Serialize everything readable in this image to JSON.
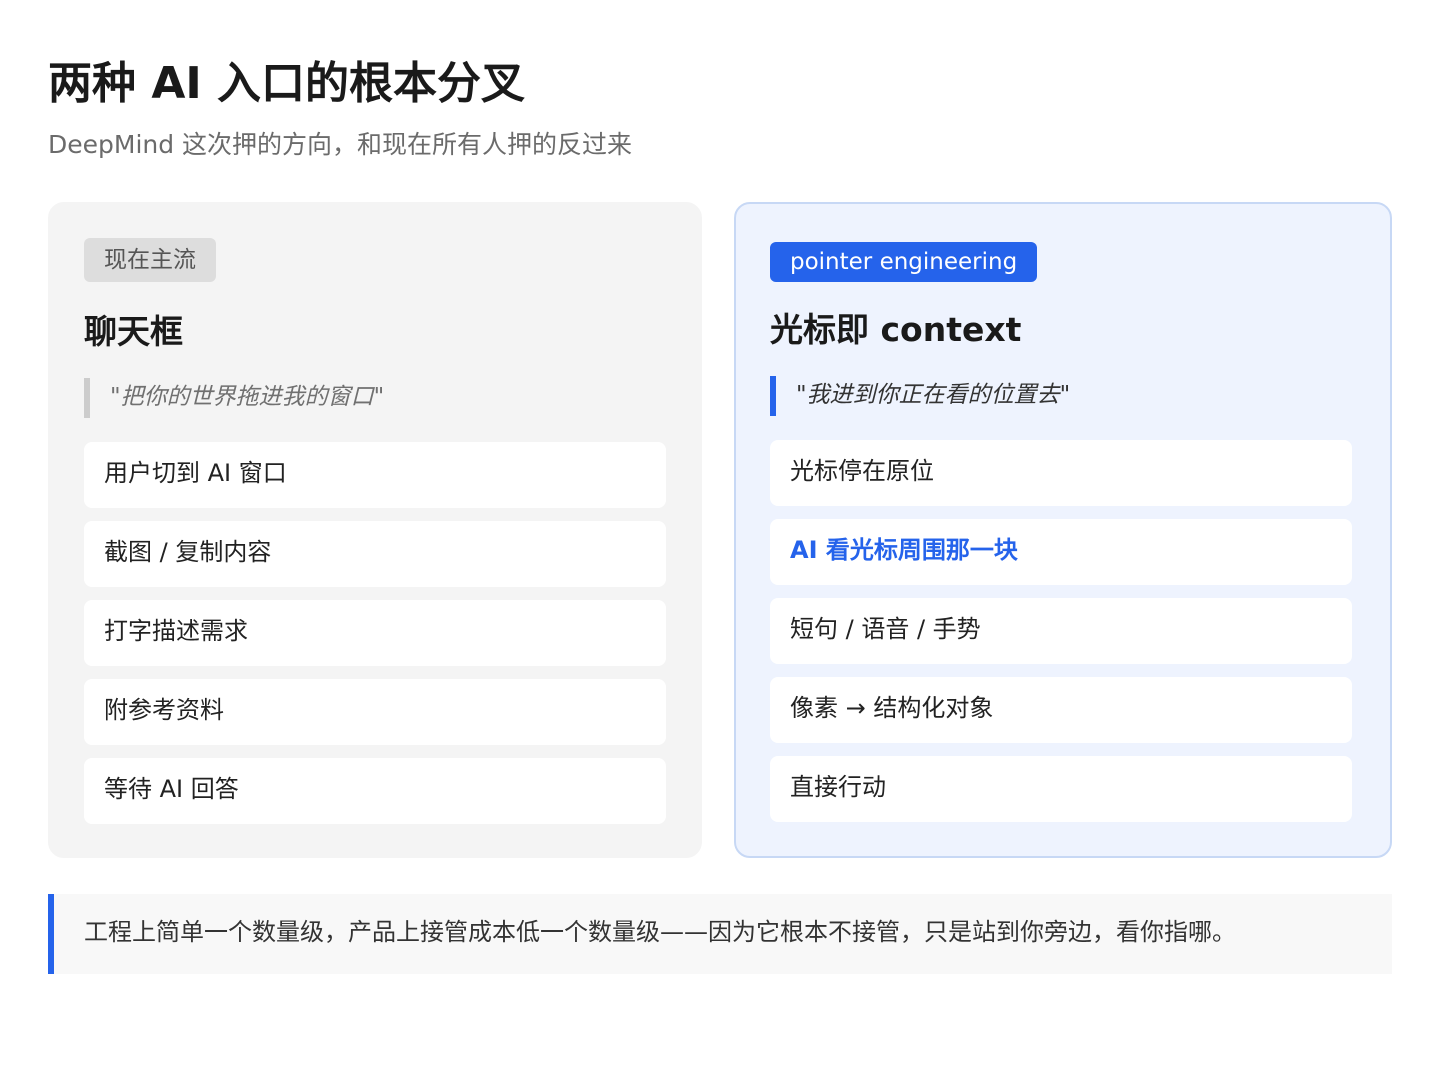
{
  "header": {
    "title": "两种 AI 入口的根本分叉",
    "subtitle": "DeepMind 这次押的方向，和现在所有人押的反过来"
  },
  "left_card": {
    "tag": "现在主流",
    "heading": "聊天框",
    "quote": "\"把你的世界拖进我的窗口\"",
    "steps": [
      "用户切到 AI 窗口",
      "截图 / 复制内容",
      "打字描述需求",
      "附参考资料",
      "等待 AI 回答"
    ]
  },
  "right_card": {
    "tag": "pointer engineering",
    "heading": "光标即 context",
    "quote": "\"我进到你正在看的位置去\"",
    "steps": [
      "光标停在原位",
      "AI 看光标周围那一块",
      "短句 / 语音 / 手势",
      "像素 → 结构化对象",
      "直接行动"
    ],
    "highlighted_step": "AI 看光标周围那一块"
  },
  "footer": {
    "note": "工程上简单一个数量级，产品上接管成本低一个数量级——因为它根本不接管，只是站到你旁边，看你指哪。"
  },
  "colors": {
    "accent": "#2563eb",
    "left_card_bg": "#f4f4f4",
    "right_card_bg": "#eef3fe",
    "right_card_border": "#c7d8f5"
  }
}
